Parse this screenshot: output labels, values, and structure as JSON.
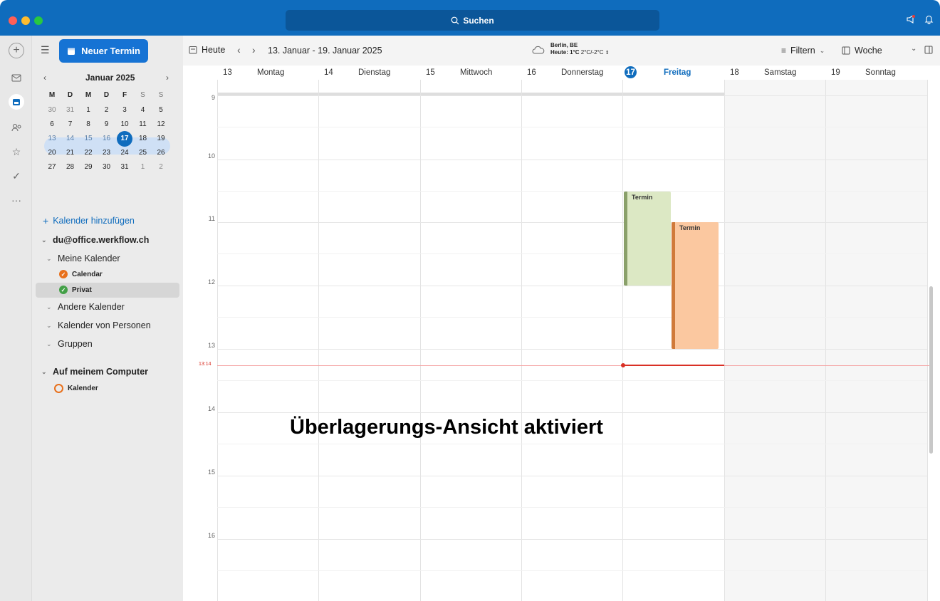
{
  "titlebar": {
    "search_label": "Suchen",
    "search_icon": "search-icon",
    "notif_icons": [
      "megaphone-icon",
      "bell-icon"
    ]
  },
  "rail": {
    "icons": [
      "plus-icon",
      "mail-icon",
      "calendar-icon",
      "people-icon",
      "star-icon",
      "todo-icon",
      "more-icon"
    ]
  },
  "sidebar": {
    "new_event_label": "Neuer Termin",
    "mini_calendar": {
      "month_label": "Januar 2025",
      "weekday_headers": [
        "M",
        "D",
        "M",
        "D",
        "F",
        "S",
        "S"
      ],
      "weeks": [
        [
          "30",
          "31",
          "1",
          "2",
          "3",
          "4",
          "5"
        ],
        [
          "6",
          "7",
          "8",
          "9",
          "10",
          "11",
          "12"
        ],
        [
          "13",
          "14",
          "15",
          "16",
          "17",
          "18",
          "19"
        ],
        [
          "20",
          "21",
          "22",
          "23",
          "24",
          "25",
          "26"
        ],
        [
          "27",
          "28",
          "29",
          "30",
          "31",
          "1",
          "2"
        ]
      ],
      "today": "17"
    },
    "add_calendar_label": "Kalender hinzufügen",
    "account_label": "du@office.werkflow.ch",
    "my_calendars_label": "Meine Kalender",
    "calendar_items": [
      {
        "label": "Calendar",
        "color": "#e8701c"
      },
      {
        "label": "Privat",
        "color": "#43a047"
      }
    ],
    "other_calendars_label": "Andere Kalender",
    "people_calendars_label": "Kalender von Personen",
    "groups_label": "Gruppen",
    "on_computer_label": "Auf meinem Computer",
    "local_calendar_label": "Kalender"
  },
  "toolbar": {
    "today_label": "Heute",
    "date_range": "13. Januar - 19. Januar 2025",
    "weather_location": "Berlin, BE",
    "weather_today": "Heute: 1°C",
    "weather_range": "2°C/-2°C",
    "filter_label": "Filtern",
    "view_label": "Woche"
  },
  "week": {
    "days": [
      {
        "num": "13",
        "name": "Montag"
      },
      {
        "num": "14",
        "name": "Dienstag"
      },
      {
        "num": "15",
        "name": "Mittwoch"
      },
      {
        "num": "16",
        "name": "Donnerstag"
      },
      {
        "num": "17",
        "name": "Freitag",
        "today": true
      },
      {
        "num": "18",
        "name": "Samstag"
      },
      {
        "num": "19",
        "name": "Sonntag"
      }
    ],
    "hour_labels": [
      "9",
      "10",
      "11",
      "12",
      "13",
      "14",
      "15",
      "16"
    ],
    "current_time": "13:14",
    "events": [
      {
        "title": "Termin",
        "day": "Freitag",
        "start": "10:30",
        "end": "12:00",
        "color": "#dce8c4",
        "bar": "#8aa06a"
      },
      {
        "title": "Termin",
        "day": "Freitag",
        "start": "11:00",
        "end": "13:00",
        "color": "#fbc8a0",
        "bar": "#d07a3a"
      }
    ]
  },
  "overlay_text": "Überlagerungs-Ansicht aktiviert"
}
